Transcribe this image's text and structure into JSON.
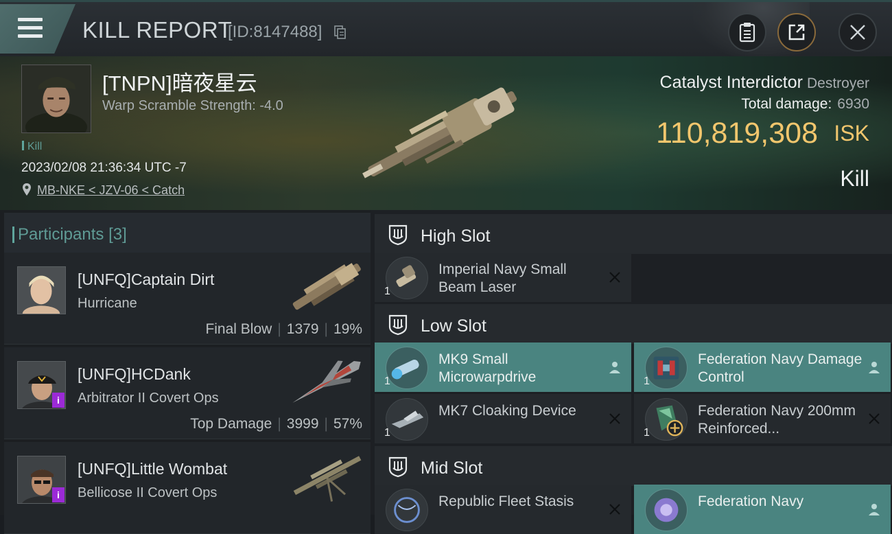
{
  "header": {
    "title": "KILL REPORT",
    "report_id": "[ID:8147488]"
  },
  "victim": {
    "name": "[TNPN]暗夜星云",
    "warp_scramble": "Warp Scramble Strength: -4.0",
    "tag": "Kill",
    "timestamp": "2023/02/08 21:36:34 UTC -7",
    "location": "MB-NKE < JZV-06 < Catch",
    "ship_name": "Catalyst Interdictor",
    "ship_class": "Destroyer",
    "total_damage_label": "Total damage:",
    "total_damage": "6930",
    "isk_value": "110,819,308",
    "isk_unit": "ISK",
    "result": "Kill"
  },
  "participants": {
    "title": "Participants",
    "count": "[3]",
    "items": [
      {
        "name": "[UNFQ]Captain Dirt",
        "ship": "Hurricane",
        "role": "Final Blow",
        "damage": "1379",
        "percent": "19%"
      },
      {
        "name": "[UNFQ]HCDank",
        "ship": "Arbitrator II Covert Ops",
        "role": "Top Damage",
        "damage": "3999",
        "percent": "57%",
        "badge": "i"
      },
      {
        "name": "[UNFQ]Little Wombat",
        "ship": "Bellicose II Covert Ops",
        "badge": "i"
      }
    ]
  },
  "slots": {
    "high": {
      "title": "High Slot",
      "modules": [
        {
          "qty": "1",
          "name": "Imperial Navy Small Beam Laser"
        }
      ]
    },
    "low": {
      "title": "Low Slot",
      "modules": [
        {
          "qty": "1",
          "name": "MK9 Small Microwarpdrive"
        },
        {
          "qty": "1",
          "name": "Federation Navy Damage Control"
        },
        {
          "qty": "1",
          "name": "MK7 Cloaking Device"
        },
        {
          "qty": "1",
          "name": "Federation Navy 200mm Reinforced..."
        }
      ]
    },
    "mid": {
      "title": "Mid Slot",
      "modules": [
        {
          "name": "Republic Fleet Stasis"
        },
        {
          "name": "Federation Navy"
        }
      ]
    }
  },
  "colors": {
    "accent_teal": "#5f9b95",
    "isk_gold": "#f2c66d",
    "active_module": "#4a8480",
    "badge_purple": "#9b2ad6"
  },
  "icons": [
    "menu-icon",
    "copy-icon",
    "clipboard-icon",
    "share-icon",
    "close-icon",
    "location-pin-icon",
    "slot-shield-icon",
    "person-icon",
    "remove-x-icon",
    "plus-icon"
  ]
}
